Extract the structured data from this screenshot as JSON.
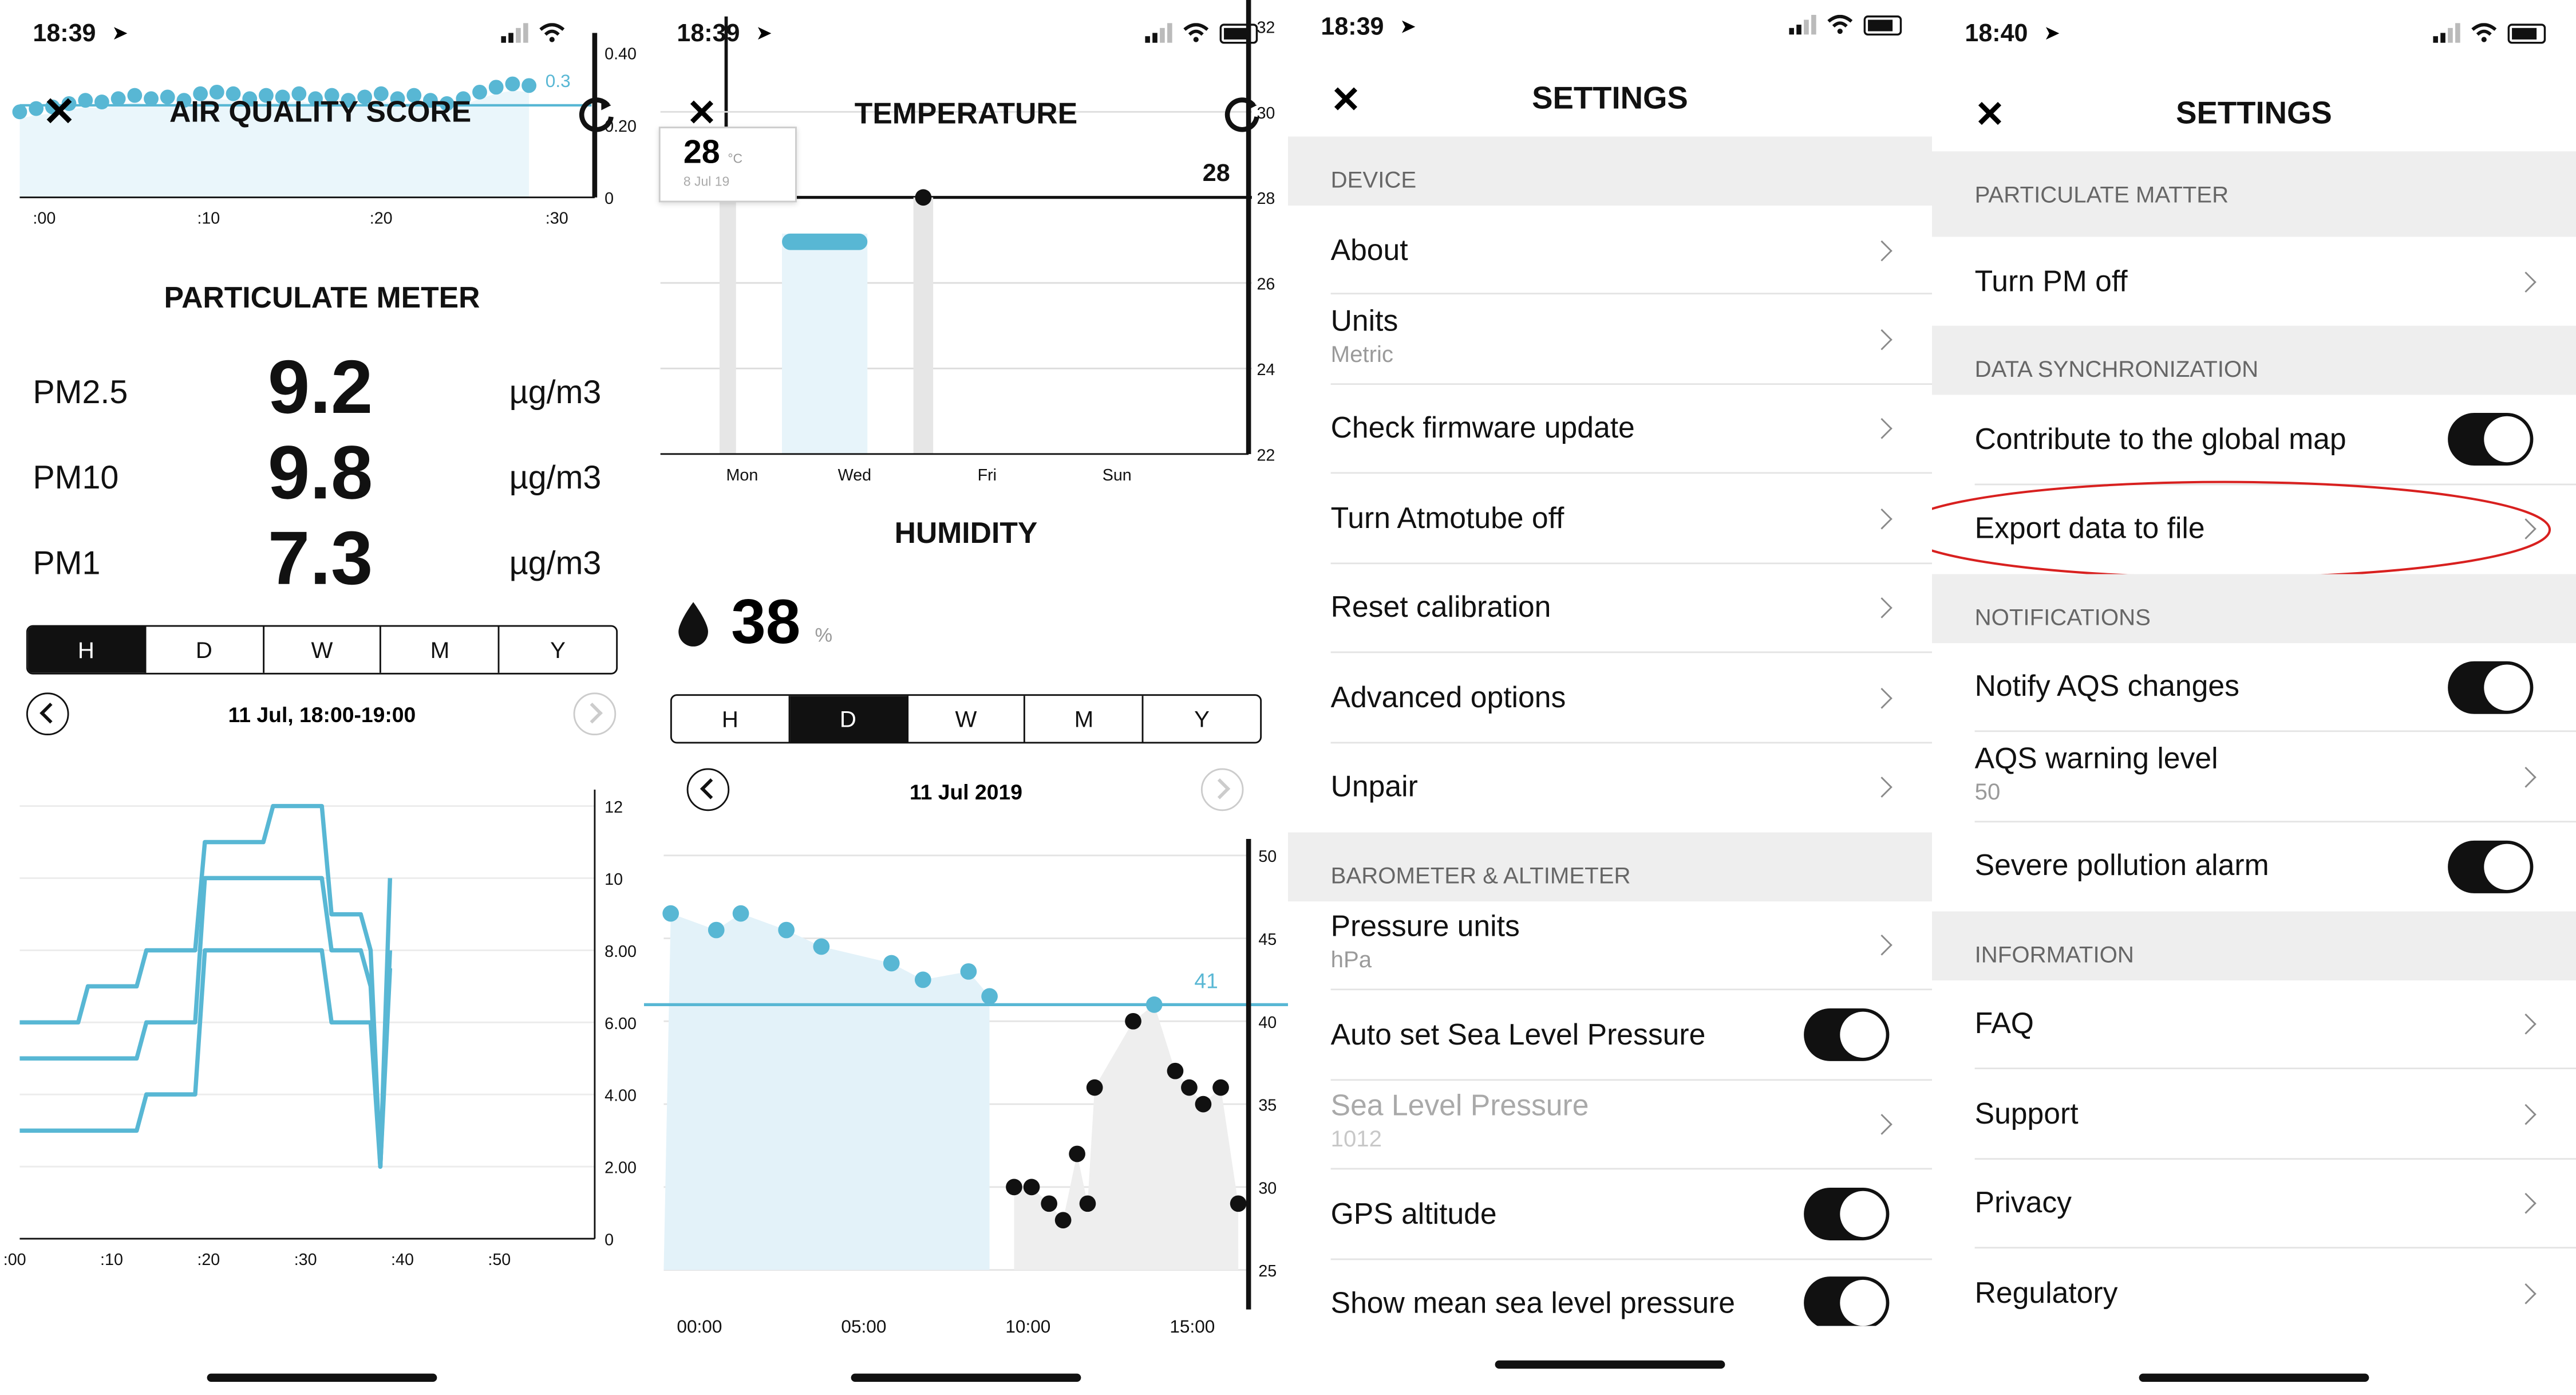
{
  "panel1": {
    "time": "18:39",
    "aqs": {
      "title": "AIR QUALITY SCORE",
      "right_ticks": [
        "0.40",
        "0.20",
        "0"
      ],
      "x_ticks": [
        ":00",
        ":10",
        ":20",
        ":30"
      ],
      "marker": "0.3"
    },
    "pm_title": "PARTICULATE METER",
    "pm": [
      {
        "label": "PM2.5",
        "value": "9.2",
        "unit": "µg/m3"
      },
      {
        "label": "PM10",
        "value": "9.8",
        "unit": "µg/m3"
      },
      {
        "label": "PM1",
        "value": "7.3",
        "unit": "µg/m3"
      }
    ],
    "tabs": [
      "H",
      "D",
      "W",
      "M",
      "Y"
    ],
    "active_tab": "H",
    "date": "11 Jul, 18:00-19:00",
    "chart_data": {
      "type": "line",
      "x_ticks": [
        ":00",
        ":10",
        ":20",
        ":30",
        ":40",
        ":50"
      ],
      "y_ticks": [
        "0",
        "2.00",
        "4.00",
        "6.00",
        "8.00",
        "10",
        "12"
      ],
      "ylim": [
        0,
        12
      ],
      "x": [
        0,
        6,
        7,
        12,
        13,
        18,
        19,
        25,
        26,
        31,
        32,
        35,
        36,
        37,
        38
      ],
      "series": [
        {
          "values": [
            6.0,
            6.0,
            7.0,
            7.0,
            8.0,
            8.0,
            11.0,
            11.0,
            12.0,
            12.0,
            9.0,
            9.0,
            8.0,
            2.0,
            10.0
          ]
        },
        {
          "values": [
            5.0,
            5.0,
            5.0,
            5.0,
            6.0,
            6.0,
            10.0,
            10.0,
            10.0,
            10.0,
            8.0,
            8.0,
            7.0,
            2.0,
            8.0
          ]
        },
        {
          "values": [
            3.0,
            3.0,
            3.0,
            3.0,
            4.0,
            4.0,
            8.0,
            8.0,
            8.0,
            8.0,
            6.0,
            6.0,
            6.0,
            2.0,
            7.5
          ]
        }
      ]
    }
  },
  "panel2": {
    "time": "18:39",
    "temperature": {
      "title": "TEMPERATURE",
      "tooltip_value": "28",
      "tooltip_unit": "°C",
      "tooltip_date": "8 Jul 19",
      "current": "28",
      "right_ticks": [
        "32",
        "30",
        "28",
        "26",
        "24",
        "22"
      ],
      "x_ticks": [
        "Mon",
        "Wed",
        "Fri",
        "Sun"
      ]
    },
    "humidity": {
      "title": "HUMIDITY",
      "value": "38",
      "unit": "%"
    },
    "tabs": [
      "H",
      "D",
      "W",
      "M",
      "Y"
    ],
    "active_tab": "D",
    "date": "11 Jul 2019",
    "chart_data": {
      "type": "scatter",
      "x_ticks": [
        "00:00",
        "05:00",
        "10:00",
        "15:00"
      ],
      "y_ticks": [
        "25",
        "30",
        "35",
        "40",
        "45",
        "50"
      ],
      "ylim": [
        25,
        50
      ],
      "threshold": 41,
      "threshold_label": "41",
      "x": [
        0.2,
        1.5,
        2.2,
        3.5,
        4.5,
        6.5,
        7.4,
        8.7,
        9.3,
        10.0,
        10.5,
        11.0,
        11.4,
        11.8,
        12.1,
        12.3,
        13.4,
        14.0,
        14.6,
        15.0,
        15.4,
        15.9,
        16.4
      ],
      "values": [
        46.5,
        45.5,
        46.5,
        45.5,
        44.5,
        43.5,
        42.5,
        43.0,
        41.5,
        30.0,
        30.0,
        29.0,
        28.0,
        32.0,
        29.0,
        36.0,
        40.0,
        41.0,
        37.0,
        36.0,
        35.0,
        36.0,
        29.0
      ]
    }
  },
  "panel3": {
    "time": "18:39",
    "title": "SETTINGS",
    "sections": [
      {
        "header": "DEVICE",
        "items": [
          {
            "label": "About"
          },
          {
            "label": "Units",
            "sub": "Metric"
          },
          {
            "label": "Check firmware update"
          },
          {
            "label": "Turn Atmotube off"
          },
          {
            "label": "Reset calibration"
          },
          {
            "label": "Advanced options"
          },
          {
            "label": "Unpair"
          }
        ]
      },
      {
        "header": "BAROMETER & ALTIMETER",
        "items": [
          {
            "label": "Pressure units",
            "sub": "hPa"
          },
          {
            "label": "Auto set Sea Level Pressure",
            "toggle": true
          },
          {
            "label": "Sea Level Pressure",
            "sub": "1012",
            "disabled": true
          },
          {
            "label": "GPS altitude",
            "toggle": true
          },
          {
            "label": "Show mean sea level pressure",
            "toggle": true
          }
        ]
      }
    ]
  },
  "panel4": {
    "time": "18:40",
    "title": "SETTINGS",
    "sections": [
      {
        "header": "PARTICULATE MATTER",
        "items": [
          {
            "label": "Turn PM off"
          }
        ]
      },
      {
        "header": "DATA SYNCHRONIZATION",
        "items": [
          {
            "label": "Contribute to the global map",
            "toggle": true
          },
          {
            "label": "Export data to file",
            "highlighted": true
          }
        ]
      },
      {
        "header": "NOTIFICATIONS",
        "items": [
          {
            "label": "Notify AQS changes",
            "toggle": true
          },
          {
            "label": "AQS warning level",
            "sub": "50"
          },
          {
            "label": "Severe pollution alarm",
            "toggle": true
          }
        ]
      },
      {
        "header": "INFORMATION",
        "items": [
          {
            "label": "FAQ"
          },
          {
            "label": "Support"
          },
          {
            "label": "Privacy"
          },
          {
            "label": "Regulatory"
          }
        ]
      }
    ],
    "highlight_color": "#d8201f"
  },
  "colors": {
    "accent": "#58b7d4",
    "dark": "#111111",
    "section_bg": "#eeeeee"
  }
}
